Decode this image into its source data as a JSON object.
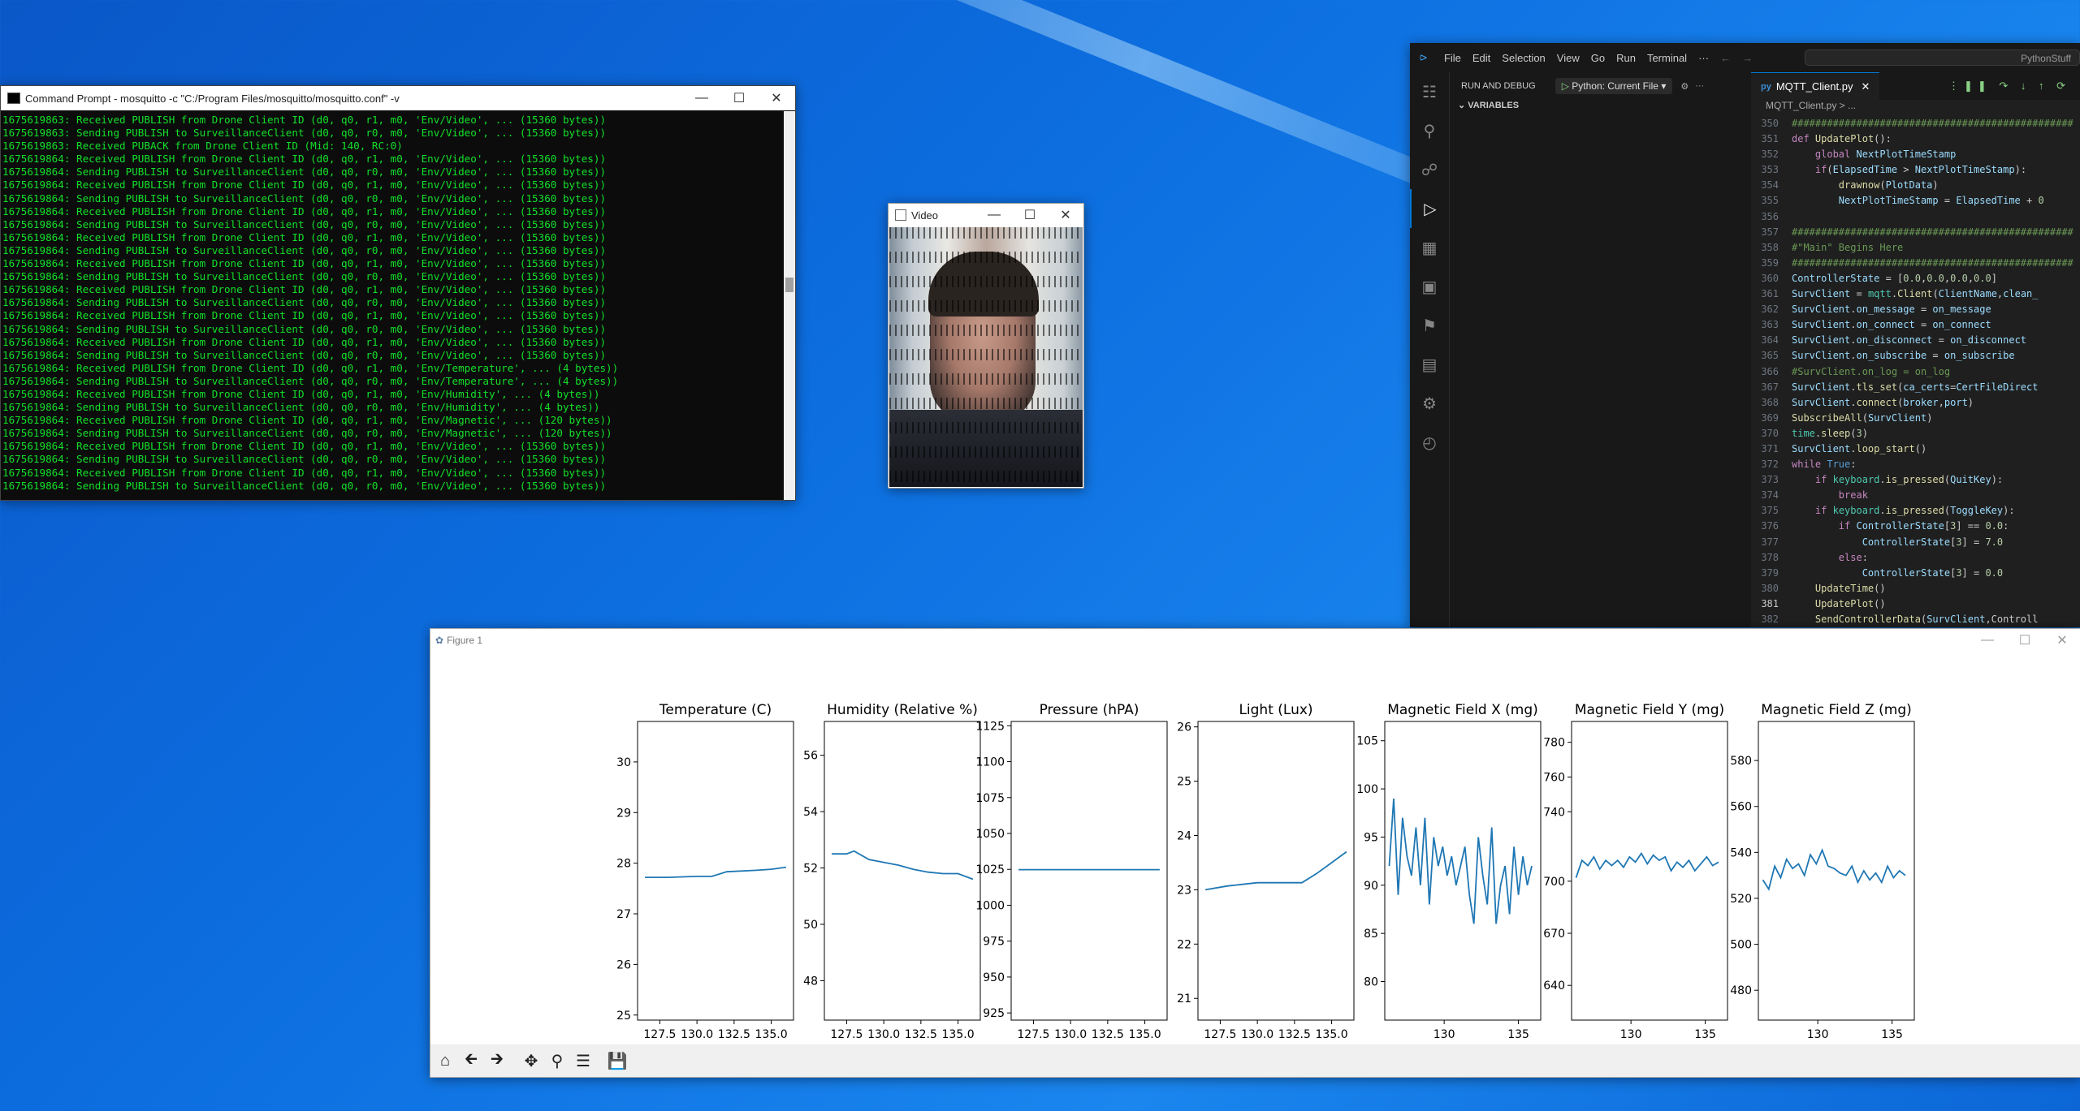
{
  "cmd": {
    "title": "Command Prompt - mosquitto  -c \"C:/Program Files/mosquitto/mosquitto.conf\" -v",
    "lines": [
      "1675619863: Received PUBLISH from Drone Client ID (d0, q0, r1, m0, 'Env/Video', ... (15360 bytes))",
      "1675619863: Sending PUBLISH to SurveillanceClient (d0, q0, r0, m0, 'Env/Video', ... (15360 bytes))",
      "1675619863: Received PUBACK from Drone Client ID (Mid: 140, RC:0)",
      "1675619864: Received PUBLISH from Drone Client ID (d0, q0, r1, m0, 'Env/Video', ... (15360 bytes))",
      "1675619864: Sending PUBLISH to SurveillanceClient (d0, q0, r0, m0, 'Env/Video', ... (15360 bytes))",
      "1675619864: Received PUBLISH from Drone Client ID (d0, q0, r1, m0, 'Env/Video', ... (15360 bytes))",
      "1675619864: Sending PUBLISH to SurveillanceClient (d0, q0, r0, m0, 'Env/Video', ... (15360 bytes))",
      "1675619864: Received PUBLISH from Drone Client ID (d0, q0, r1, m0, 'Env/Video', ... (15360 bytes))",
      "1675619864: Sending PUBLISH to SurveillanceClient (d0, q0, r0, m0, 'Env/Video', ... (15360 bytes))",
      "1675619864: Received PUBLISH from Drone Client ID (d0, q0, r1, m0, 'Env/Video', ... (15360 bytes))",
      "1675619864: Sending PUBLISH to SurveillanceClient (d0, q0, r0, m0, 'Env/Video', ... (15360 bytes))",
      "1675619864: Received PUBLISH from Drone Client ID (d0, q0, r1, m0, 'Env/Video', ... (15360 bytes))",
      "1675619864: Sending PUBLISH to SurveillanceClient (d0, q0, r0, m0, 'Env/Video', ... (15360 bytes))",
      "1675619864: Received PUBLISH from Drone Client ID (d0, q0, r1, m0, 'Env/Video', ... (15360 bytes))",
      "1675619864: Sending PUBLISH to SurveillanceClient (d0, q0, r0, m0, 'Env/Video', ... (15360 bytes))",
      "1675619864: Received PUBLISH from Drone Client ID (d0, q0, r1, m0, 'Env/Video', ... (15360 bytes))",
      "1675619864: Sending PUBLISH to SurveillanceClient (d0, q0, r0, m0, 'Env/Video', ... (15360 bytes))",
      "1675619864: Received PUBLISH from Drone Client ID (d0, q0, r1, m0, 'Env/Video', ... (15360 bytes))",
      "1675619864: Sending PUBLISH to SurveillanceClient (d0, q0, r0, m0, 'Env/Video', ... (15360 bytes))",
      "1675619864: Received PUBLISH from Drone Client ID (d0, q0, r1, m0, 'Env/Temperature', ... (4 bytes))",
      "1675619864: Sending PUBLISH to SurveillanceClient (d0, q0, r0, m0, 'Env/Temperature', ... (4 bytes))",
      "1675619864: Received PUBLISH from Drone Client ID (d0, q0, r1, m0, 'Env/Humidity', ... (4 bytes))",
      "1675619864: Sending PUBLISH to SurveillanceClient (d0, q0, r0, m0, 'Env/Humidity', ... (4 bytes))",
      "1675619864: Received PUBLISH from Drone Client ID (d0, q0, r1, m0, 'Env/Magnetic', ... (120 bytes))",
      "1675619864: Sending PUBLISH to SurveillanceClient (d0, q0, r0, m0, 'Env/Magnetic', ... (120 bytes))",
      "1675619864: Received PUBLISH from Drone Client ID (d0, q0, r1, m0, 'Env/Video', ... (15360 bytes))",
      "1675619864: Sending PUBLISH to SurveillanceClient (d0, q0, r0, m0, 'Env/Video', ... (15360 bytes))",
      "1675619864: Received PUBLISH from Drone Client ID (d0, q0, r1, m0, 'Env/Video', ... (15360 bytes))",
      "1675619864: Sending PUBLISH to SurveillanceClient (d0, q0, r0, m0, 'Env/Video', ... (15360 bytes))"
    ]
  },
  "video": {
    "title": "Video"
  },
  "vscode": {
    "menu": [
      "File",
      "Edit",
      "Selection",
      "View",
      "Go",
      "Run",
      "Terminal",
      "···"
    ],
    "search_text": "PythonStuff",
    "side_title": "RUN AND DEBUG",
    "run_config": "Python: Current File",
    "variables_label": "VARIABLES",
    "tab_label": "MQTT_Client.py",
    "breadcrumb": "MQTT_Client.py > ...",
    "line_numbers": [
      "350",
      "351",
      "352",
      "353",
      "354",
      "355",
      "356",
      "357",
      "358",
      "359",
      "360",
      "361",
      "362",
      "363",
      "364",
      "365",
      "366",
      "367",
      "368",
      "369",
      "370",
      "371",
      "372",
      "373",
      "374",
      "375",
      "376",
      "377",
      "378",
      "379",
      "380",
      "381",
      "382"
    ],
    "current_line": "381",
    "code_lines": [
      "################################################",
      "def UpdatePlot():",
      "    global NextPlotTimeStamp",
      "    if(ElapsedTime > NextPlotTimeStamp):",
      "        drawnow(PlotData)",
      "        NextPlotTimeStamp = ElapsedTime + 0",
      "",
      "################################################",
      "#\"Main\" Begins Here",
      "################################################",
      "ControllerState = [0.0,0.0,0.0,0.0]",
      "SurvClient = mqtt.Client(ClientName,clean_",
      "SurvClient.on_message = on_message",
      "SurvClient.on_connect = on_connect",
      "SurvClient.on_disconnect = on_disconnect",
      "SurvClient.on_subscribe = on_subscribe",
      "#SurvClient.on_log = on_log",
      "SurvClient.tls_set(ca_certs=CertFileDirect",
      "SurvClient.connect(broker,port)",
      "SubscribeAll(SurvClient)",
      "time.sleep(3)",
      "SurvClient.loop_start()",
      "while True:",
      "    if keyboard.is_pressed(QuitKey):",
      "        break",
      "    if keyboard.is_pressed(ToggleKey):",
      "        if ControllerState[3] == 0.0:",
      "            ControllerState[3] = 7.0",
      "        else:",
      "            ControllerState[3] = 0.0",
      "    UpdateTime()",
      "    UpdatePlot()",
      "    SendControllerData(SurvClient,Controll"
    ]
  },
  "figure": {
    "title": "Figure 1",
    "toolbar": [
      "home-icon",
      "back-icon",
      "forward-icon",
      "pan-icon",
      "zoom-icon",
      "configure-icon",
      "save-icon"
    ]
  },
  "chart_data": [
    {
      "type": "line",
      "title": "Temperature (C)",
      "x": [
        126.5,
        128,
        130,
        131,
        132,
        134,
        135,
        136
      ],
      "y": [
        27.72,
        27.72,
        27.74,
        27.74,
        27.83,
        27.86,
        27.88,
        27.92
      ],
      "xticks": [
        "127.5",
        "130.0",
        "132.5",
        "135.0"
      ],
      "yticks": [
        "25",
        "26",
        "27",
        "28",
        "29",
        "30"
      ],
      "xlim": [
        126.0,
        136.5
      ],
      "ylim": [
        24.9,
        30.8
      ]
    },
    {
      "type": "line",
      "title": "Humidity (Relative %)",
      "x": [
        126.5,
        127.5,
        128,
        129,
        130,
        131,
        132,
        133,
        134,
        135,
        136
      ],
      "y": [
        52.5,
        52.5,
        52.6,
        52.3,
        52.2,
        52.1,
        51.95,
        51.85,
        51.8,
        51.8,
        51.6
      ],
      "xticks": [
        "127.5",
        "130.0",
        "132.5",
        "135.0"
      ],
      "yticks": [
        "48",
        "50",
        "52",
        "54",
        "56"
      ],
      "xlim": [
        126.0,
        136.5
      ],
      "ylim": [
        46.6,
        57.2
      ]
    },
    {
      "type": "line",
      "title": "Pressure (hPA)",
      "x": [
        126.5,
        136
      ],
      "y": [
        1024.8,
        1024.8
      ],
      "xticks": [
        "127.5",
        "130.0",
        "132.5",
        "135.0"
      ],
      "yticks": [
        "925",
        "950",
        "975",
        "1000",
        "1025",
        "1050",
        "1075",
        "1100",
        "1125"
      ],
      "xlim": [
        126.0,
        136.5
      ],
      "ylim": [
        920,
        1128
      ]
    },
    {
      "type": "line",
      "title": "Light (Lux)",
      "x": [
        126.5,
        128,
        130,
        131,
        132,
        133,
        134,
        135,
        136
      ],
      "y": [
        23.0,
        23.07,
        23.13,
        23.13,
        23.13,
        23.13,
        23.3,
        23.5,
        23.7
      ],
      "xticks": [
        "127.5",
        "130.0",
        "132.5",
        "135.0"
      ],
      "yticks": [
        "21",
        "22",
        "23",
        "24",
        "25",
        "26"
      ],
      "xlim": [
        126.0,
        136.5
      ],
      "ylim": [
        20.6,
        26.1
      ]
    },
    {
      "type": "line",
      "title": "Magnetic Field X (mg)",
      "x": [
        126.3,
        126.6,
        126.9,
        127.2,
        127.5,
        127.8,
        128.1,
        128.4,
        128.7,
        129.0,
        129.3,
        129.6,
        129.9,
        130.2,
        130.5,
        130.8,
        131.1,
        131.4,
        131.7,
        132.0,
        132.3,
        132.6,
        132.9,
        133.2,
        133.5,
        133.8,
        134.1,
        134.4,
        134.7,
        135.0,
        135.3,
        135.6,
        135.9
      ],
      "y": [
        92,
        99,
        89,
        97,
        93,
        91,
        96,
        90,
        97,
        88,
        95,
        92,
        94,
        91,
        93,
        90,
        92,
        94,
        89,
        86,
        95,
        91,
        88,
        96,
        86,
        90,
        92,
        87,
        94,
        89,
        93,
        90,
        92
      ],
      "xticks": [
        "130",
        "135"
      ],
      "yticks": [
        "80",
        "85",
        "90",
        "95",
        "100",
        "105"
      ],
      "xlim": [
        126.0,
        136.5
      ],
      "ylim": [
        76,
        107
      ]
    },
    {
      "type": "line",
      "title": "Magnetic Field Y (mg)",
      "x": [
        126.3,
        126.7,
        127.1,
        127.5,
        127.9,
        128.3,
        128.7,
        129.1,
        129.5,
        129.9,
        130.3,
        130.7,
        131.1,
        131.5,
        131.9,
        132.3,
        132.7,
        133.1,
        133.5,
        133.9,
        134.3,
        134.7,
        135.1,
        135.5,
        135.9
      ],
      "y": [
        702,
        712,
        709,
        714,
        707,
        712,
        709,
        712,
        708,
        714,
        711,
        716,
        710,
        715,
        712,
        714,
        706,
        711,
        708,
        712,
        706,
        710,
        714,
        709,
        711
      ],
      "xticks": [
        "130",
        "135"
      ],
      "yticks": [
        "640",
        "670",
        "700",
        "740",
        "760",
        "780"
      ],
      "xlim": [
        126.0,
        136.5
      ],
      "ylim": [
        620,
        792
      ]
    },
    {
      "type": "line",
      "title": "Magnetic Field Z (mg)",
      "x": [
        126.3,
        126.7,
        127.1,
        127.5,
        127.9,
        128.3,
        128.7,
        129.1,
        129.5,
        129.9,
        130.3,
        130.7,
        131.1,
        131.5,
        131.9,
        132.3,
        132.7,
        133.1,
        133.5,
        133.9,
        134.3,
        134.7,
        135.1,
        135.5,
        135.9
      ],
      "y": [
        528,
        524,
        534,
        529,
        537,
        533,
        535,
        530,
        539,
        535,
        541,
        534,
        533,
        531,
        530,
        534,
        527,
        532,
        528,
        531,
        527,
        534,
        529,
        532,
        530
      ],
      "xticks": [
        "130",
        "135"
      ],
      "yticks": [
        "480",
        "500",
        "520",
        "540",
        "560",
        "580"
      ],
      "xlim": [
        126.0,
        136.5
      ],
      "ylim": [
        467,
        597
      ]
    }
  ]
}
